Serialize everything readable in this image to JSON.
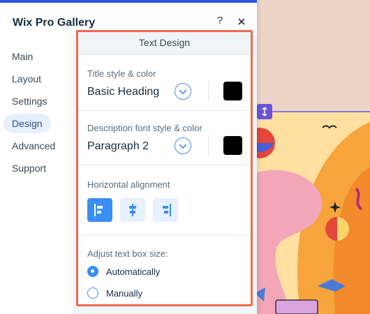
{
  "colors": {
    "accent": "#3b8ef3",
    "highlight": "#ef6a4f",
    "topbar": "#2f55e4",
    "handle": "#6b54d8"
  },
  "header": {
    "title": "Wix Pro Gallery",
    "help_icon": "?",
    "close_icon": "close-icon"
  },
  "sidebar": {
    "items": [
      {
        "label": "Main"
      },
      {
        "label": "Layout"
      },
      {
        "label": "Settings"
      },
      {
        "label": "Design",
        "active": true
      },
      {
        "label": "Advanced"
      },
      {
        "label": "Support"
      }
    ]
  },
  "design": {
    "section_title": "Text Design",
    "title_style": {
      "label": "Title style & color",
      "value": "Basic Heading",
      "color": "#000000"
    },
    "description_style": {
      "label": "Description font style & color",
      "value": "Paragraph 2",
      "color": "#000000"
    },
    "alignment": {
      "label": "Horizontal alignment",
      "options": [
        "left",
        "center",
        "right"
      ],
      "selected": "left"
    },
    "text_box_size": {
      "label": "Adjust text box size:",
      "options": [
        {
          "label": "Automatically",
          "selected": true
        },
        {
          "label": "Manually",
          "selected": false
        }
      ]
    }
  },
  "canvas": {
    "handle_icon": "resize-vertical-icon"
  }
}
